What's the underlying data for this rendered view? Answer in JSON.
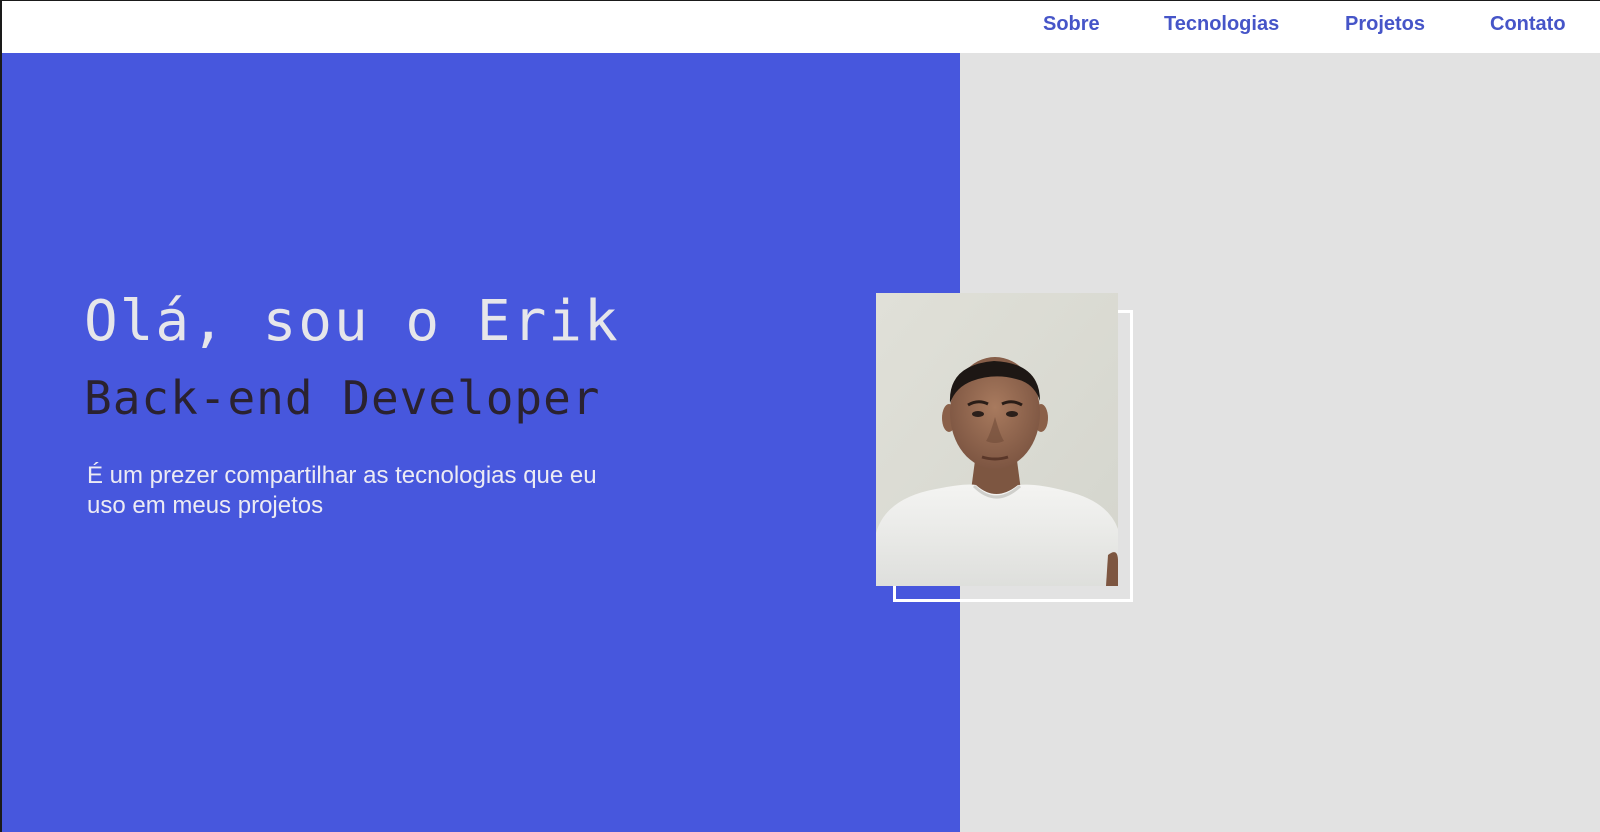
{
  "nav": {
    "links": [
      "Sobre",
      "Tecnologias",
      "Projetos",
      "Contato"
    ]
  },
  "hero": {
    "greeting": "Olá, sou o Erik",
    "role": "Back-end Developer",
    "tagline": "É um prezer compartilhar as tecnologias que eu uso em meus projetos",
    "photo": "profile-photo"
  },
  "colors": {
    "accent": "#4757dd",
    "nav_link": "#4655c8",
    "right_panel": "#e2e2e2",
    "role_text": "#2a2230",
    "greeting_text": "#e6e6ea"
  }
}
